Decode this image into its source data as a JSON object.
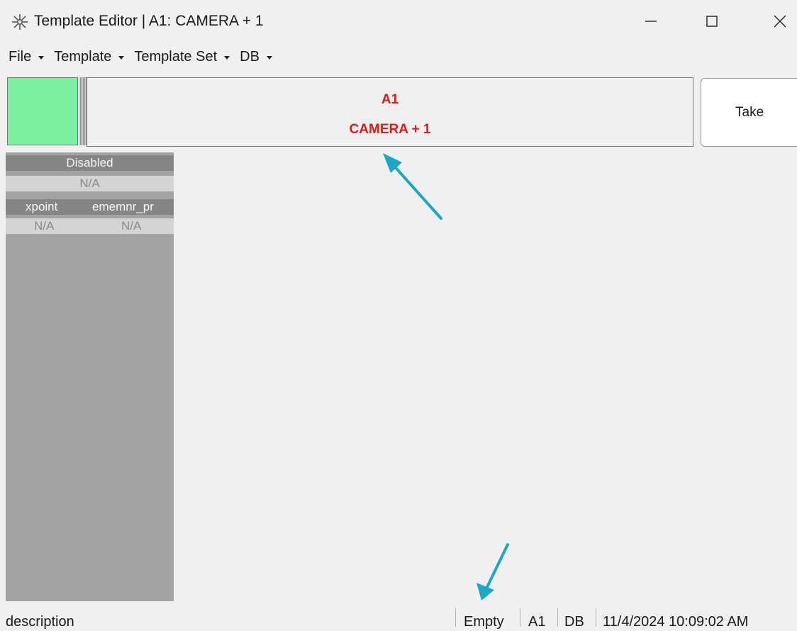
{
  "window": {
    "title": "Template Editor | A1: CAMERA + 1",
    "minimize_glyph": "—",
    "maximize_glyph": "☐",
    "close_glyph": "✕"
  },
  "menu": [
    {
      "label": "File"
    },
    {
      "label": "Template"
    },
    {
      "label": "Template Set"
    },
    {
      "label": "DB"
    }
  ],
  "header": {
    "line1": "A1",
    "line2": "CAMERA + 1",
    "status_color": "#7df0a2",
    "text_color": "#e01a1a"
  },
  "take_button": {
    "label": "Take"
  },
  "left_panel": {
    "section1_header": "Disabled",
    "section1_value": "N/A",
    "col1_header": "xpoint",
    "col2_header": "ememnr_pr",
    "col1_value": "N/A",
    "col2_value": "N/A"
  },
  "statusbar": {
    "description": "description",
    "state": "Empty",
    "address": "A1",
    "db": "DB",
    "timestamp": "11/4/2024 10:09:02 AM"
  },
  "annotations": {
    "arrow_color": "#1ba8c8"
  }
}
